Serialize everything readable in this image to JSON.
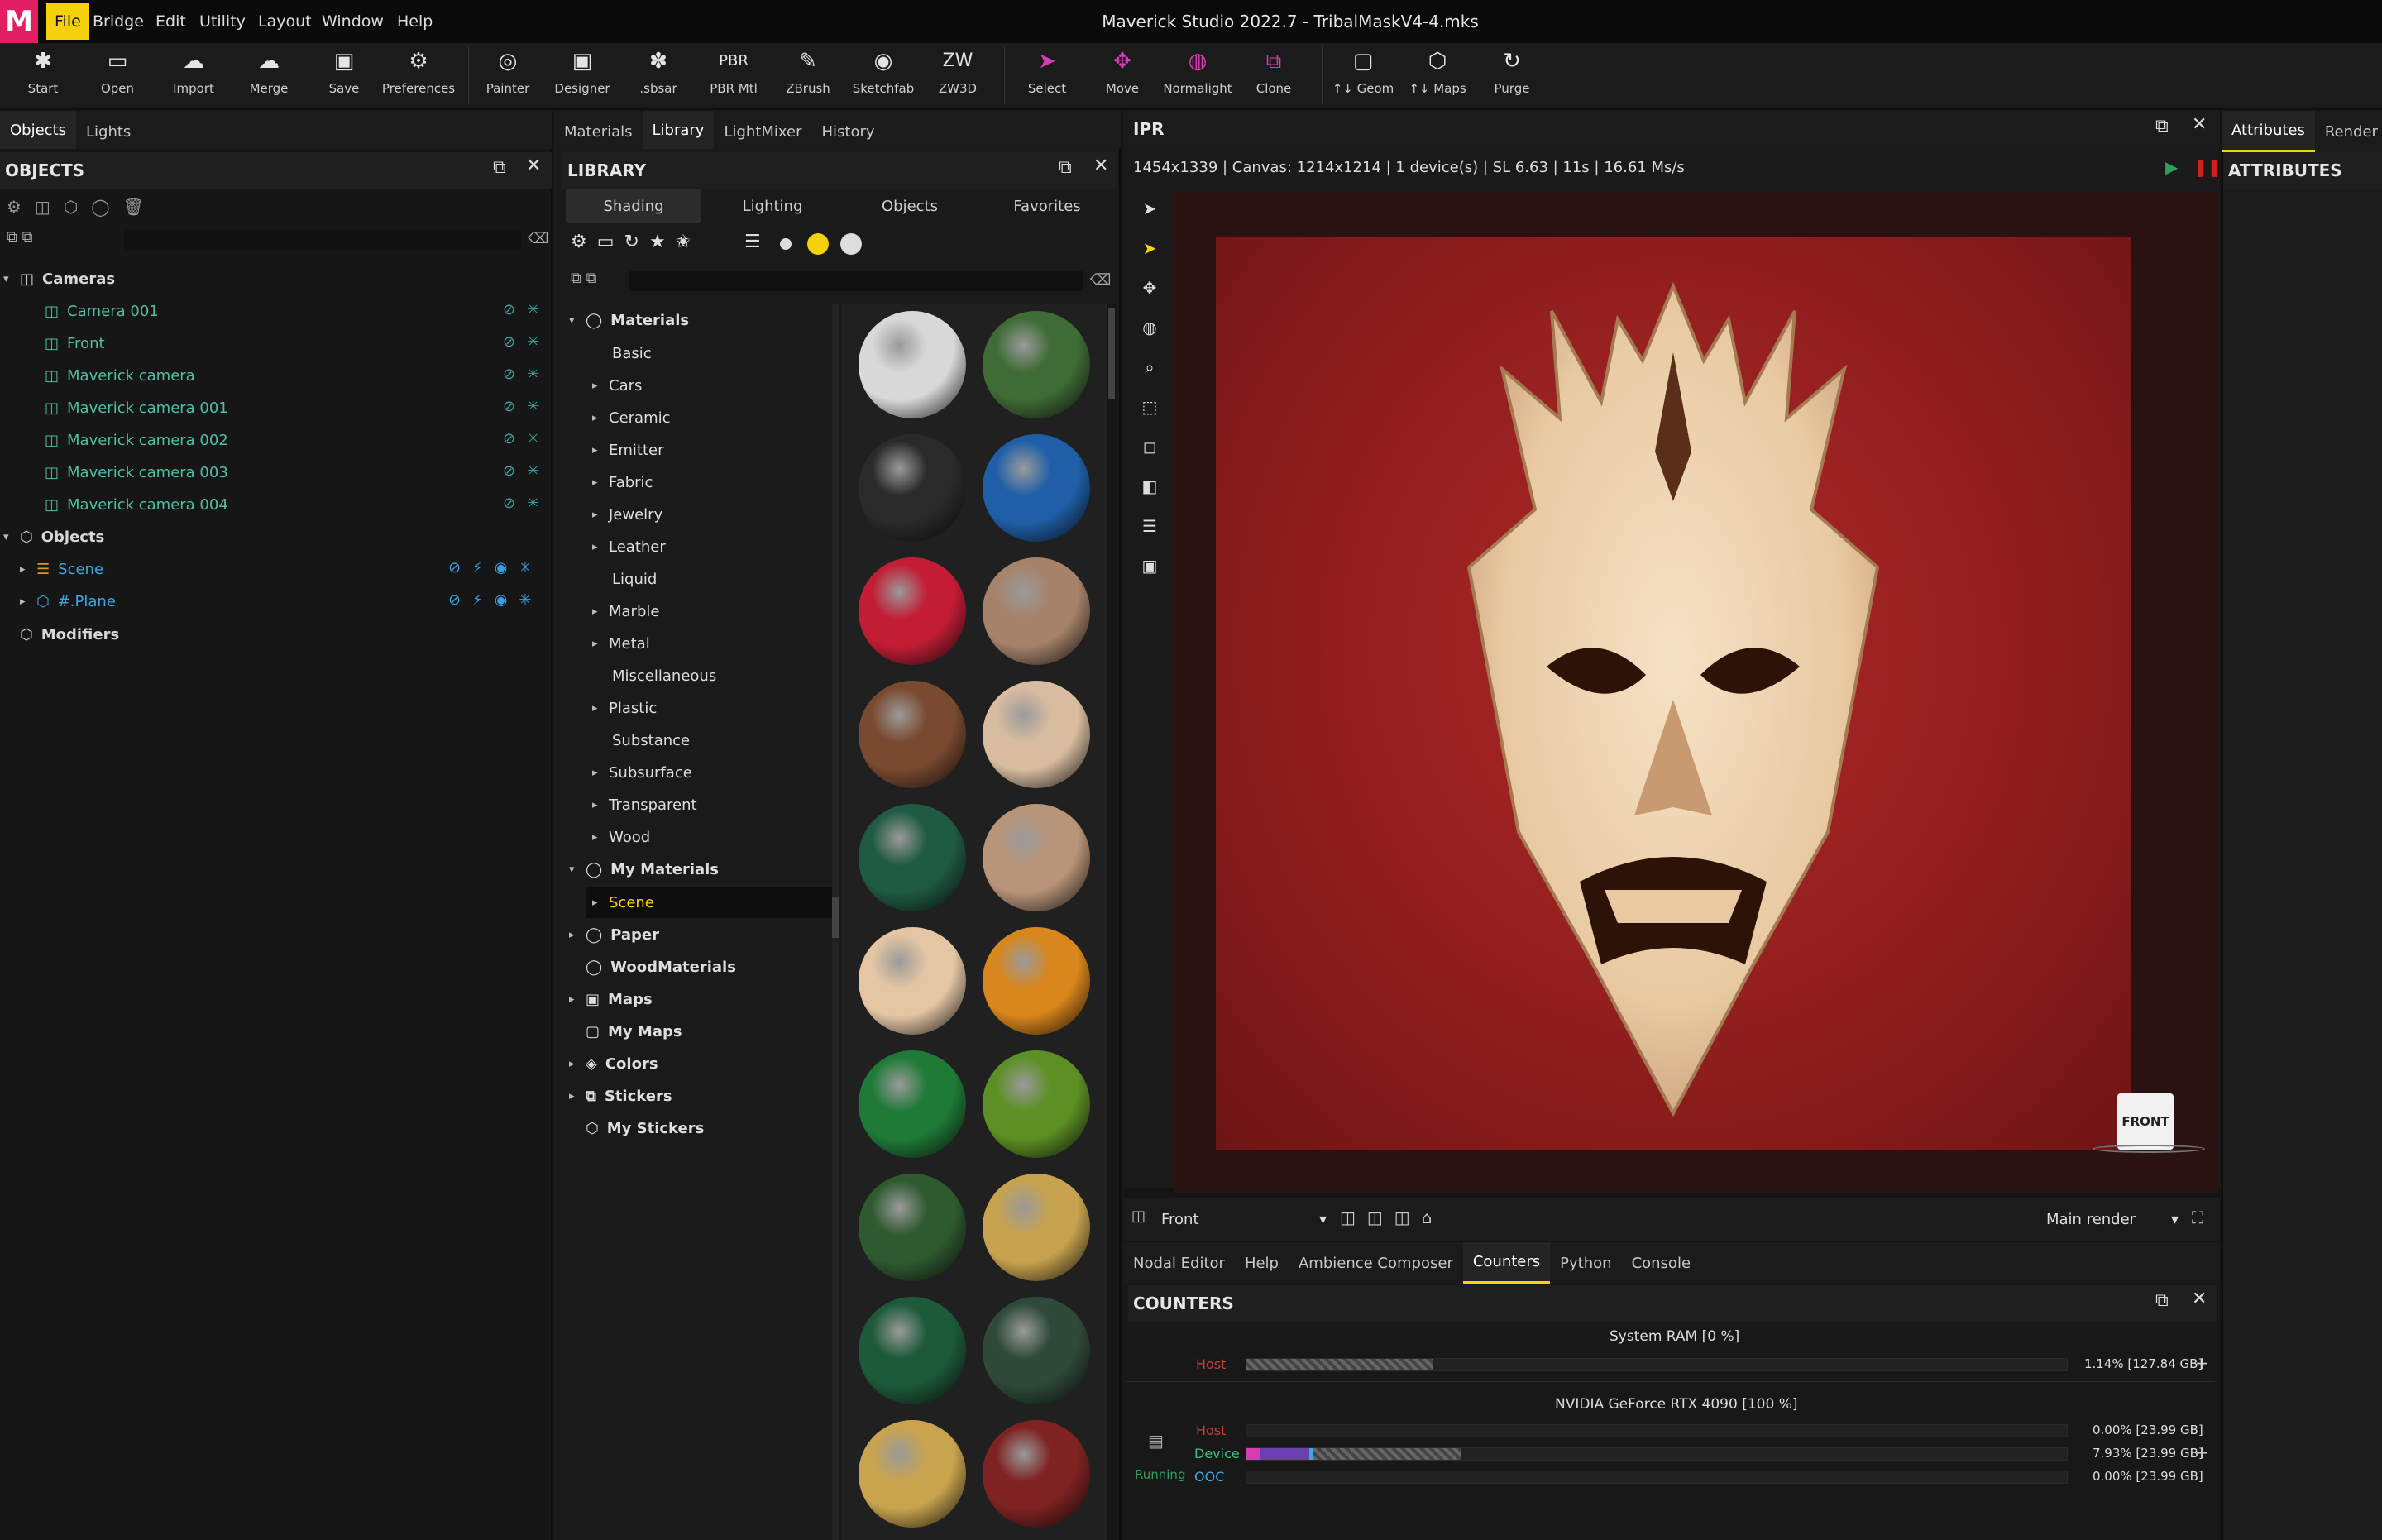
{
  "app": {
    "title": "Maverick Studio 2022.7 - TribalMaskV4-4.mks",
    "logo": "M"
  },
  "menu": [
    "File",
    "Bridge",
    "Edit",
    "Utility",
    "Layout",
    "Window",
    "Help"
  ],
  "toolbar": [
    {
      "label": "Start",
      "icon": "✱"
    },
    {
      "label": "Open",
      "icon": "▭"
    },
    {
      "label": "Import",
      "icon": "☁"
    },
    {
      "label": "Merge",
      "icon": "☁"
    },
    {
      "label": "Save",
      "icon": "▣"
    },
    {
      "label": "Preferences",
      "icon": "⚙"
    },
    {
      "label": "Painter",
      "icon": "◎"
    },
    {
      "label": "Designer",
      "icon": "▣"
    },
    {
      "label": ".sbsar",
      "icon": "✽"
    },
    {
      "label": "PBR Mtl",
      "icon": "PBR"
    },
    {
      "label": "ZBrush",
      "icon": "✎"
    },
    {
      "label": "Sketchfab",
      "icon": "◉"
    },
    {
      "label": "ZW3D",
      "icon": "ZW"
    },
    {
      "label": "Select",
      "icon": "➤"
    },
    {
      "label": "Move",
      "icon": "✥"
    },
    {
      "label": "Normalight",
      "icon": "◍"
    },
    {
      "label": "Clone",
      "icon": "⧉"
    },
    {
      "label": "↑↓ Geom",
      "icon": "▢"
    },
    {
      "label": "↑↓ Maps",
      "icon": "⬡"
    },
    {
      "label": "Purge",
      "icon": "↻"
    }
  ],
  "left_tabs": [
    "Objects",
    "Lights"
  ],
  "objects_panel": {
    "title": "OBJECTS",
    "cameras_label": "Cameras",
    "cameras": [
      "Camera 001",
      "Front",
      "Maverick camera",
      "Maverick camera 001",
      "Maverick camera 002",
      "Maverick camera 003",
      "Maverick camera 004"
    ],
    "objects_label": "Objects",
    "objects": [
      "Scene",
      "#.Plane"
    ],
    "modifiers_label": "Modifiers"
  },
  "mid_tabs": [
    "Materials",
    "Library",
    "LightMixer",
    "History"
  ],
  "library": {
    "title": "LIBRARY",
    "tabs": [
      "Shading",
      "Lighting",
      "Objects",
      "Favorites"
    ],
    "materials_label": "Materials",
    "materials": [
      "Basic",
      "Cars",
      "Ceramic",
      "Emitter",
      "Fabric",
      "Jewelry",
      "Leather",
      "Liquid",
      "Marble",
      "Metal",
      "Miscellaneous",
      "Plastic",
      "Substance",
      "Subsurface",
      "Transparent",
      "Wood"
    ],
    "my_materials_label": "My Materials",
    "scene": "Scene",
    "paper": "Paper",
    "wood_materials": "WoodMaterials",
    "maps": "Maps",
    "my_maps": "My Maps",
    "colors": "Colors",
    "stickers": "Stickers",
    "my_stickers": "My Stickers"
  },
  "swatch_colors": [
    "#d9d9d9",
    "#3f6b35",
    "#2a2a2a",
    "#1f5fa8",
    "#c21d35",
    "#a6826a",
    "#7a4a30",
    "#d8bca0",
    "#1f5a42",
    "#b89478",
    "#e4c6a4",
    "#d9861c",
    "#1f7a38",
    "#5c8f24",
    "#2f5a30",
    "#c7a34f",
    "#1c5a3a",
    "#2f4a3a",
    "#c9a44e",
    "#7e2222"
  ],
  "ipr": {
    "title": "IPR",
    "stats": "1454x1339  |  Canvas: 1214x1214  |  1 device(s)  |  SL 6.63  |  11s  |  16.61 Ms/s",
    "camera": "Front",
    "render": "Main render",
    "cube_label": "FRONT"
  },
  "bottom_tabs": [
    "Nodal Editor",
    "Help",
    "Ambience Composer",
    "Counters",
    "Python",
    "Console"
  ],
  "counters": {
    "title": "COUNTERS",
    "ram_title": "System RAM  [0 %]",
    "ram_host": "Host",
    "ram_host_value": "1.14% [127.84 GB]",
    "gpu_title": "NVIDIA GeForce RTX 4090  [100 %]",
    "gpu_host": "Host",
    "gpu_host_value": "0.00% [23.99 GB]",
    "gpu_device": "Device",
    "gpu_device_value": "7.93% [23.99 GB]",
    "gpu_ooc": "OOC",
    "gpu_ooc_value": "0.00% [23.99 GB]",
    "status": "Running"
  },
  "right_tabs": [
    "Attributes",
    "Render"
  ],
  "attributes": {
    "title": "ATTRIBUTES"
  }
}
